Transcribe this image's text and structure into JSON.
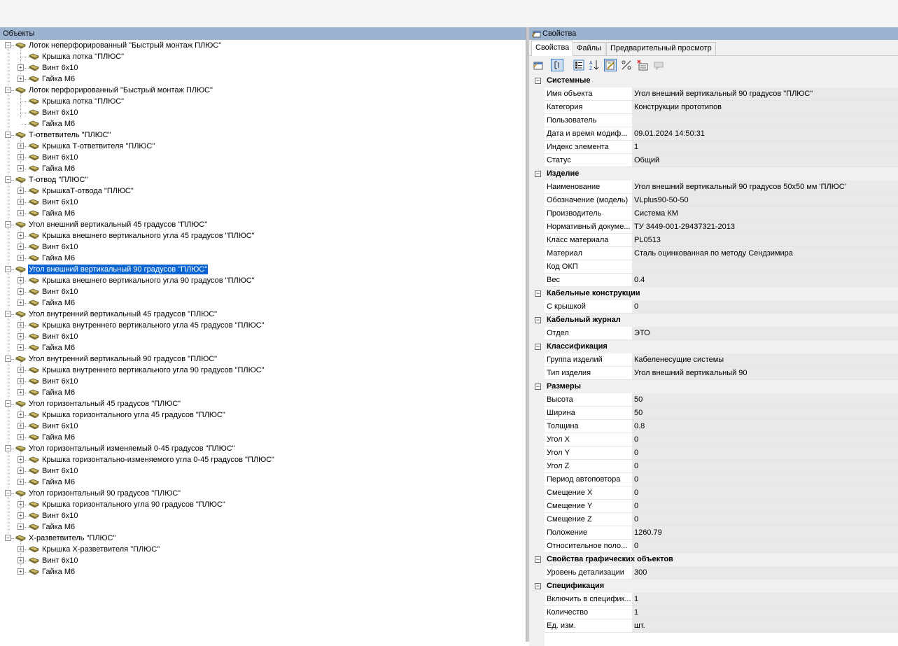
{
  "objects_panel": {
    "title": "Объекты",
    "tree": [
      {
        "label": "Лоток неперфорированный \"Быстрый монтаж ПЛЮС\"",
        "children": [
          {
            "label": "Крышка лотка \"ПЛЮС\"",
            "expandable": false
          },
          {
            "label": "Винт 6x10",
            "expandable": true
          },
          {
            "label": "Гайка М6",
            "expandable": true
          }
        ]
      },
      {
        "label": "Лоток перфорированный \"Быстрый монтаж ПЛЮС\"",
        "children": [
          {
            "label": "Крышка лотка \"ПЛЮС\"",
            "expandable": false
          },
          {
            "label": "Винт 6x10",
            "expandable": false
          },
          {
            "label": "Гайка М6",
            "expandable": false
          }
        ]
      },
      {
        "label": "Т-ответвитель \"ПЛЮС\"",
        "children": [
          {
            "label": "Крышка Т-ответвителя \"ПЛЮС\"",
            "expandable": true
          },
          {
            "label": "Винт 6x10",
            "expandable": true
          },
          {
            "label": "Гайка М6",
            "expandable": true
          }
        ]
      },
      {
        "label": "Т-отвод \"ПЛЮС\"",
        "children": [
          {
            "label": "КрышкаТ-отвода \"ПЛЮС\"",
            "expandable": true
          },
          {
            "label": "Винт 6x10",
            "expandable": true
          },
          {
            "label": "Гайка М6",
            "expandable": true
          }
        ]
      },
      {
        "label": "Угол внешний вертикальный 45 градусов \"ПЛЮС\"",
        "children": [
          {
            "label": "Крышка внешнего вертикального угла 45 градусов \"ПЛЮС\"",
            "expandable": true
          },
          {
            "label": "Винт 6x10",
            "expandable": true
          },
          {
            "label": "Гайка М6",
            "expandable": true
          }
        ]
      },
      {
        "label": "Угол внешний вертикальный 90 градусов \"ПЛЮС\"",
        "selected": true,
        "children": [
          {
            "label": "Крышка внешнего вертикального угла 90 градусов \"ПЛЮС\"",
            "expandable": true
          },
          {
            "label": "Винт 6x10",
            "expandable": true
          },
          {
            "label": "Гайка М6",
            "expandable": true
          }
        ]
      },
      {
        "label": "Угол внутренний вертикальный 45 градусов \"ПЛЮС\"",
        "children": [
          {
            "label": "Крышка внутреннего вертикального угла 45 градусов \"ПЛЮС\"",
            "expandable": true
          },
          {
            "label": "Винт 6x10",
            "expandable": true
          },
          {
            "label": "Гайка М6",
            "expandable": true
          }
        ]
      },
      {
        "label": "Угол внутренний вертикальный 90 градусов \"ПЛЮС\"",
        "children": [
          {
            "label": "Крышка внутреннего вертикального угла 90 градусов \"ПЛЮС\"",
            "expandable": true
          },
          {
            "label": "Винт 6x10",
            "expandable": true
          },
          {
            "label": "Гайка М6",
            "expandable": true
          }
        ]
      },
      {
        "label": "Угол горизонтальный 45 градусов \"ПЛЮС\"",
        "children": [
          {
            "label": "Крышка горизонтального угла 45 градусов \"ПЛЮС\"",
            "expandable": true
          },
          {
            "label": "Винт 6x10",
            "expandable": true
          },
          {
            "label": "Гайка М6",
            "expandable": true
          }
        ]
      },
      {
        "label": "Угол горизонтальный изменяемый 0-45 градусов \"ПЛЮС\"",
        "children": [
          {
            "label": "Крышка горизонтально-изменяемого угла 0-45 градусов \"ПЛЮС\"",
            "expandable": true
          },
          {
            "label": "Винт 6x10",
            "expandable": true
          },
          {
            "label": "Гайка М6",
            "expandable": true
          }
        ]
      },
      {
        "label": "Угол горизонтальный 90 градусов \"ПЛЮС\"",
        "children": [
          {
            "label": "Крышка горизонтального угла 90 градусов \"ПЛЮС\"",
            "expandable": true
          },
          {
            "label": "Винт 6x10",
            "expandable": true
          },
          {
            "label": "Гайка М6",
            "expandable": true
          }
        ]
      },
      {
        "label": "Х-разветвитель \"ПЛЮС\"",
        "children": [
          {
            "label": "Крышка Х-разветвителя \"ПЛЮС\"",
            "expandable": true
          },
          {
            "label": "Винт 6x10",
            "expandable": true
          },
          {
            "label": "Гайка М6",
            "expandable": true
          }
        ]
      }
    ]
  },
  "properties_panel": {
    "title": "Свойства",
    "tabs": [
      "Свойства",
      "Файлы",
      "Предварительный просмотр"
    ],
    "active_tab": 0,
    "toolbar_icons": [
      "properties-page-icon",
      "categorized-icon",
      "group-icon",
      "sort-az-icon",
      "edit-icon",
      "calc-icon",
      "delete-icon",
      "grid-icon",
      "comment-icon"
    ],
    "categories": [
      {
        "name": "Системные",
        "rows": [
          [
            "Имя объекта",
            "Угол внешний вертикальный 90 градусов \"ПЛЮС\""
          ],
          [
            "Категория",
            "Конструкции прототипов"
          ],
          [
            "Пользователь",
            ""
          ],
          [
            "Дата и время модиф...",
            "09.01.2024 14:50:31"
          ],
          [
            "Индекс элемента",
            "1"
          ],
          [
            "Статус",
            "Общий"
          ]
        ]
      },
      {
        "name": "Изделие",
        "rows": [
          [
            "Наименование",
            "Угол внешний вертикальный 90 градусов 50x50 мм 'ПЛЮС'"
          ],
          [
            "Обозначение (модель)",
            "VLplus90-50-50"
          ],
          [
            "Производитель",
            "Система КМ"
          ],
          [
            "Нормативный докуме...",
            "ТУ 3449-001-29437321-2013"
          ],
          [
            "Класс материала",
            "PL0513"
          ],
          [
            "Материал",
            "Сталь оцинкованная по методу Сендзимира"
          ],
          [
            "Код ОКП",
            ""
          ],
          [
            "Вес",
            "0.4"
          ]
        ]
      },
      {
        "name": "Кабельные конструкции",
        "rows": [
          [
            "С крышкой",
            "0"
          ]
        ]
      },
      {
        "name": "Кабельный журнал",
        "rows": [
          [
            "Отдел",
            "ЭТО"
          ]
        ]
      },
      {
        "name": "Классификация",
        "rows": [
          [
            "Группа изделий",
            "Кабеленесущие системы"
          ],
          [
            "Тип изделия",
            "Угол внешний вертикальный 90"
          ]
        ]
      },
      {
        "name": "Размеры",
        "rows": [
          [
            "Высота",
            "50"
          ],
          [
            "Ширина",
            "50"
          ],
          [
            "Толщина",
            "0.8"
          ],
          [
            "Угол X",
            "0"
          ],
          [
            "Угол Y",
            "0"
          ],
          [
            "Угол Z",
            "0"
          ],
          [
            "Период автоповтора",
            "0"
          ],
          [
            "Смещение X",
            "0"
          ],
          [
            "Смещение Y",
            "0"
          ],
          [
            "Смещение Z",
            "0"
          ],
          [
            "Положение",
            "1260.79"
          ],
          [
            "Относительное поло...",
            "0"
          ]
        ]
      },
      {
        "name": "Свойства графических объектов",
        "rows": [
          [
            "Уровень детализации",
            "300"
          ]
        ]
      },
      {
        "name": "Спецификация",
        "rows": [
          [
            "Включить в специфик...",
            "1"
          ],
          [
            "Количество",
            "1"
          ],
          [
            "Ед. изм.",
            "шт."
          ]
        ]
      }
    ]
  },
  "colors": {
    "header_bg": "#9db4d1",
    "selection_bg": "#0a64d2",
    "value_bg": "#e9e9e9"
  }
}
